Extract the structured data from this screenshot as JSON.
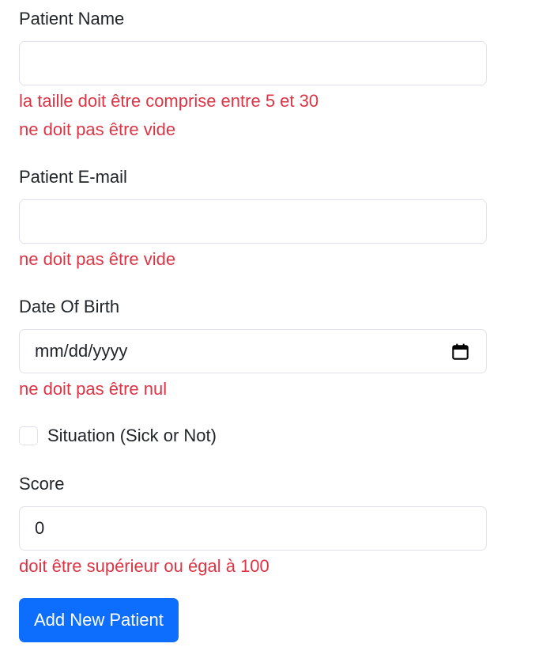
{
  "form": {
    "name": {
      "label": "Patient Name",
      "value": "",
      "errors": [
        "la taille doit être comprise entre 5 et 30",
        "ne doit pas être vide"
      ]
    },
    "email": {
      "label": "Patient E-mail",
      "value": "",
      "errors": [
        "ne doit pas être vide"
      ]
    },
    "dob": {
      "label": "Date Of Birth",
      "placeholder": "mm/dd/yyyy",
      "icon": "calendar-icon",
      "errors": [
        "ne doit pas être nul"
      ]
    },
    "situation": {
      "label": "Situation (Sick or Not)",
      "checked": false
    },
    "score": {
      "label": "Score",
      "value": "0",
      "errors": [
        "doit être supérieur ou égal à 100"
      ]
    },
    "submit_label": "Add New Patient"
  },
  "colors": {
    "error": "#dc3545",
    "primary": "#0d6efd",
    "border": "#dee2e6"
  }
}
